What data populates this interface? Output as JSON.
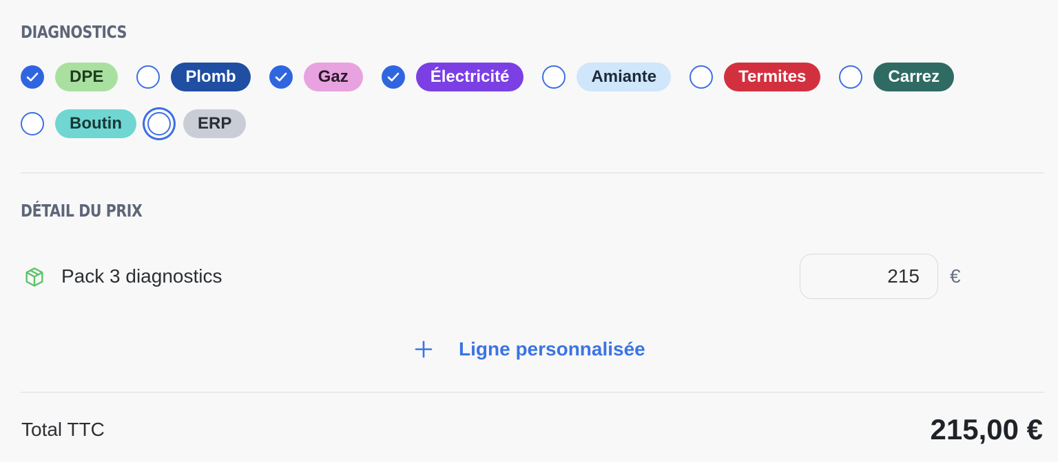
{
  "diagnostics": {
    "title": "DIAGNOSTICS",
    "items": [
      {
        "label": "DPE",
        "checked": true,
        "bg": "#a9e0a0",
        "fg": "#1f3b1f"
      },
      {
        "label": "Plomb",
        "checked": false,
        "bg": "#1f4ea3",
        "fg": "#ffffff"
      },
      {
        "label": "Gaz",
        "checked": true,
        "bg": "#e8a2e0",
        "fg": "#2a1a2a"
      },
      {
        "label": "Électricité",
        "checked": true,
        "bg": "#7b3fe4",
        "fg": "#ffffff"
      },
      {
        "label": "Amiante",
        "checked": false,
        "bg": "#cfe6fb",
        "fg": "#1d2a38"
      },
      {
        "label": "Termites",
        "checked": false,
        "bg": "#d3303f",
        "fg": "#ffffff"
      },
      {
        "label": "Carrez",
        "checked": false,
        "bg": "#2f6b63",
        "fg": "#ffffff"
      },
      {
        "label": "Boutin",
        "checked": false,
        "bg": "#6fd6d2",
        "fg": "#173836"
      },
      {
        "label": "ERP",
        "checked": false,
        "focused": true,
        "bg": "#c9cdd5",
        "fg": "#2a2e36"
      }
    ]
  },
  "price_detail": {
    "title": "DÉTAIL DU PRIX",
    "line": {
      "icon": "package-icon",
      "label": "Pack 3 diagnostics",
      "amount": "215",
      "currency": "€"
    },
    "add_custom_label": "Ligne personnalisée"
  },
  "total": {
    "label": "Total TTC",
    "value": "215,00 €"
  },
  "colors": {
    "accent": "#2f66e0",
    "link": "#3b74e3",
    "icon_green": "#5cc46a"
  }
}
